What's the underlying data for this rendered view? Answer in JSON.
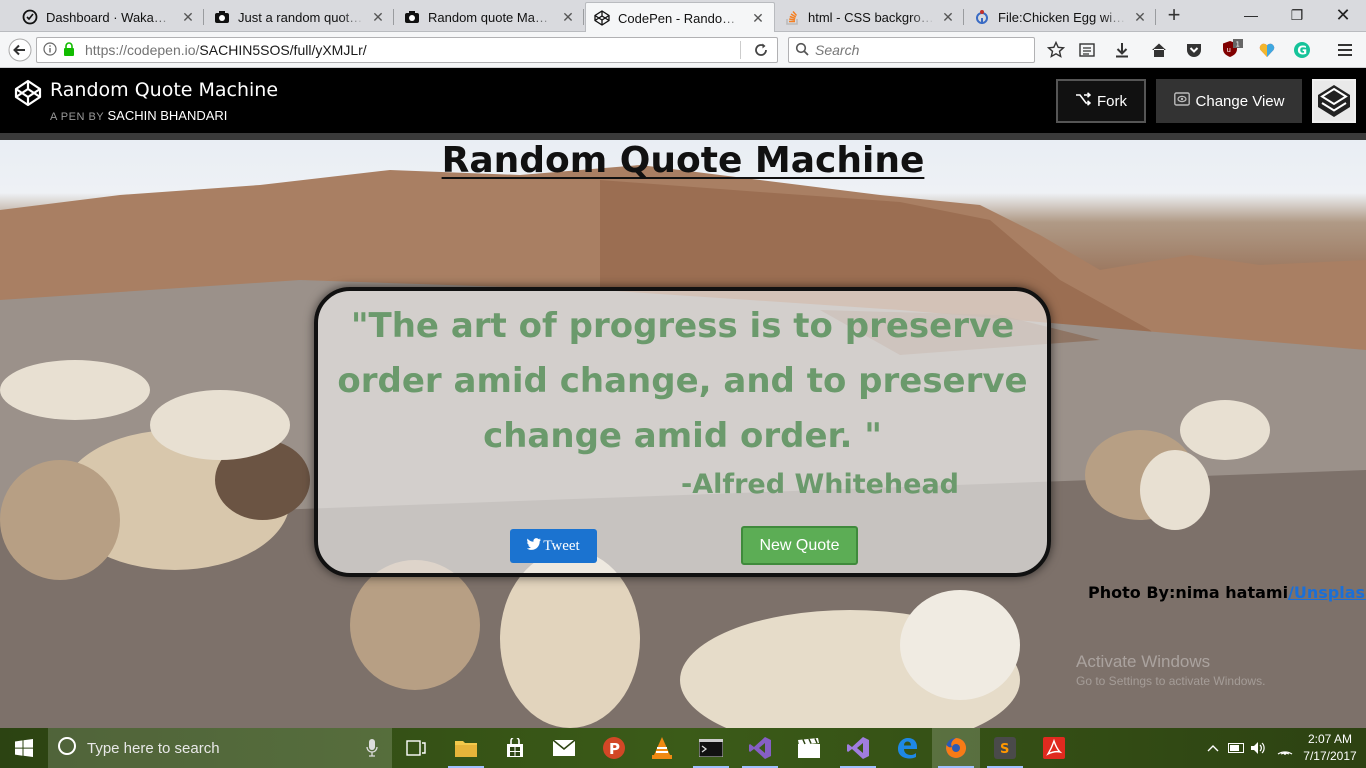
{
  "browser": {
    "tabs": [
      {
        "title": "Dashboard · WakaTime",
        "icon": "wakatime-icon"
      },
      {
        "title": "Just a random quote ma",
        "icon": "camera-icon"
      },
      {
        "title": "Random quote Machine",
        "icon": "camera-icon"
      },
      {
        "title": "CodePen - Random Quo",
        "icon": "codepen-icon",
        "active": true
      },
      {
        "title": "html - CSS background i",
        "icon": "stackoverflow-icon"
      },
      {
        "title": "File:Chicken Egg without",
        "icon": "wikimedia-icon"
      }
    ],
    "url_host": "https://codepen.io/",
    "url_path": "SACHIN5SOS/full/yXMJLr/",
    "search_placeholder": "Search",
    "ublock_badge": "1"
  },
  "codepen": {
    "title": "Random Quote Machine",
    "by_prefix": "A PEN BY",
    "author": "SACHIN BHANDARI",
    "fork_label": "Fork",
    "change_view_label": "Change View"
  },
  "page": {
    "heading": "Random Quote Machine",
    "quote": "\"The art of progress is to preserve order amid change, and to preserve change amid order. \"",
    "author": "-Alfred Whitehead",
    "tweet_label": "Tweet",
    "new_quote_label": "New Quote",
    "credit_prefix": "Photo By:nima hatami",
    "credit_link": "/Unsplash",
    "watermark_line1": "Activate Windows",
    "watermark_line2": "Go to Settings to activate Windows."
  },
  "colors": {
    "quote_text": "#6b9a6c",
    "tweet_button": "#1b73d0",
    "new_quote_button": "#5cad55",
    "credit_link": "#1a6fd8"
  },
  "taskbar": {
    "search_placeholder": "Type here to search",
    "time": "2:07 AM",
    "date": "7/17/2017"
  }
}
